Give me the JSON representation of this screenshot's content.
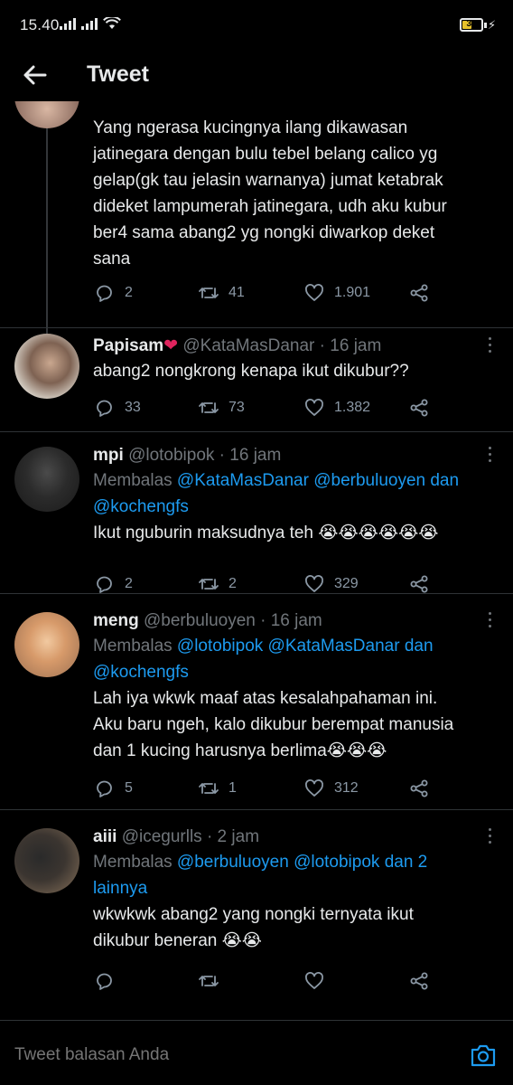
{
  "status_bar": {
    "time": "15.40",
    "battery": "38",
    "battery_color": "#e8c22b"
  },
  "app_bar": {
    "title": "Tweet",
    "back_icon": "arrow-left-icon"
  },
  "colors": {
    "background": "#000000",
    "text": "#e7e9ea",
    "muted": "#71767b",
    "mention": "#1d9bf0",
    "like_heart": "#e0245e"
  },
  "tweets": [
    {
      "text_lines": [
        "Yang ngerasa kucingnya ilang dikawasan",
        "jatinegara dengan bulu tebel belang calico yg",
        "gelap(gk tau jelasin warnanya) jumat ketabrak",
        "dideket lampumerah jatinegara, udh aku kubur",
        "ber4 sama abang2 yg nongki diwarkop deket",
        "sana"
      ],
      "replies": "2",
      "retweets": "41",
      "likes": "1.901"
    },
    {
      "name": "Papisam",
      "name_emoji": "red-heart-icon",
      "handle": "@KataMasDanar",
      "time": " · 16 jam",
      "text": "abang2 nongkrong kenapa ikut dikubur??",
      "replies": "33",
      "retweets": "73",
      "likes": "1.382"
    },
    {
      "name": "mpi",
      "handle": "@lotobipok",
      "time": " · 16 jam",
      "replying_prefix": "Membalas ",
      "replying_mentions_line1": "@KataMasDanar @berbuluoyen dan",
      "replying_mentions_line2": "@kochengfs",
      "text": "Ikut nguburin maksudnya teh 😭😭😭😭😭😭",
      "replies": "2",
      "retweets": "2",
      "likes": "329"
    },
    {
      "name": "meng",
      "handle": "@berbuluoyen",
      "time": " · 16 jam",
      "replying_prefix": "Membalas ",
      "replying_mentions_line1": "@lotobipok @KataMasDanar dan",
      "replying_mentions_line2": "@kochengfs",
      "text_lines": [
        "Lah iya wkwk maaf atas kesalahpahaman ini.",
        "Aku baru ngeh, kalo dikubur berempat manusia",
        "dan 1 kucing harusnya berlima😭😭😭"
      ],
      "replies": "5",
      "retweets": "1",
      "likes": "312"
    },
    {
      "name": "aiii",
      "handle": "@icegurlls",
      "time": " · 2 jam",
      "replying_prefix": "Membalas ",
      "replying_mentions_line1": "@berbuluoyen @lotobipok dan 2",
      "replying_mentions_line2": "lainnya",
      "text_lines": [
        "wkwkwk abang2 yang nongki ternyata ikut",
        "dikubur beneran 😭😭"
      ],
      "replies": "",
      "retweets": "",
      "likes": ""
    }
  ],
  "composer": {
    "placeholder": "Tweet balasan Anda",
    "camera_icon": "camera-icon"
  }
}
